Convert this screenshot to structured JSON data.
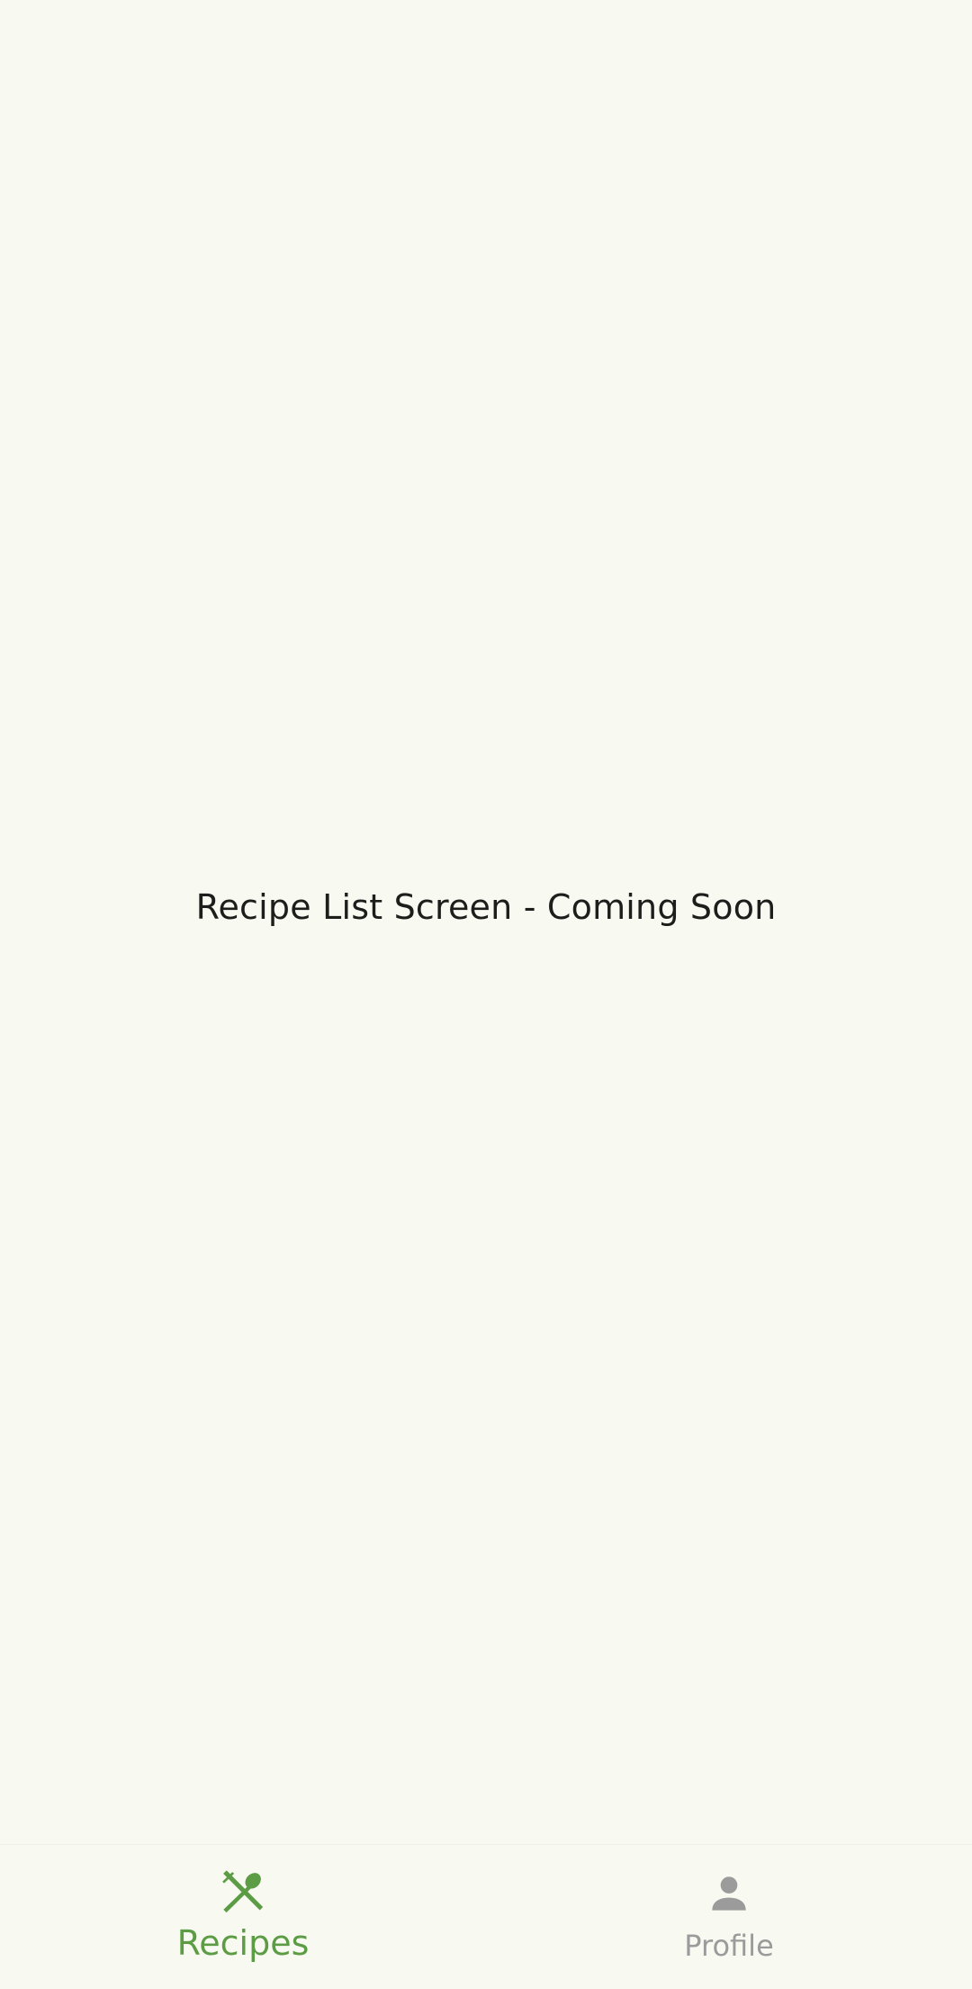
{
  "main": {
    "placeholder_text": "Recipe List Screen - Coming Soon"
  },
  "bottom_nav": {
    "items": [
      {
        "label": "Recipes",
        "icon": "fork-spoon-icon",
        "active": true
      },
      {
        "label": "Profile",
        "icon": "person-icon",
        "active": false
      }
    ]
  },
  "colors": {
    "background": "#f8f9f1",
    "accent": "#5c9c45",
    "inactive": "#9b9b9b",
    "text": "#1d1d1b"
  }
}
